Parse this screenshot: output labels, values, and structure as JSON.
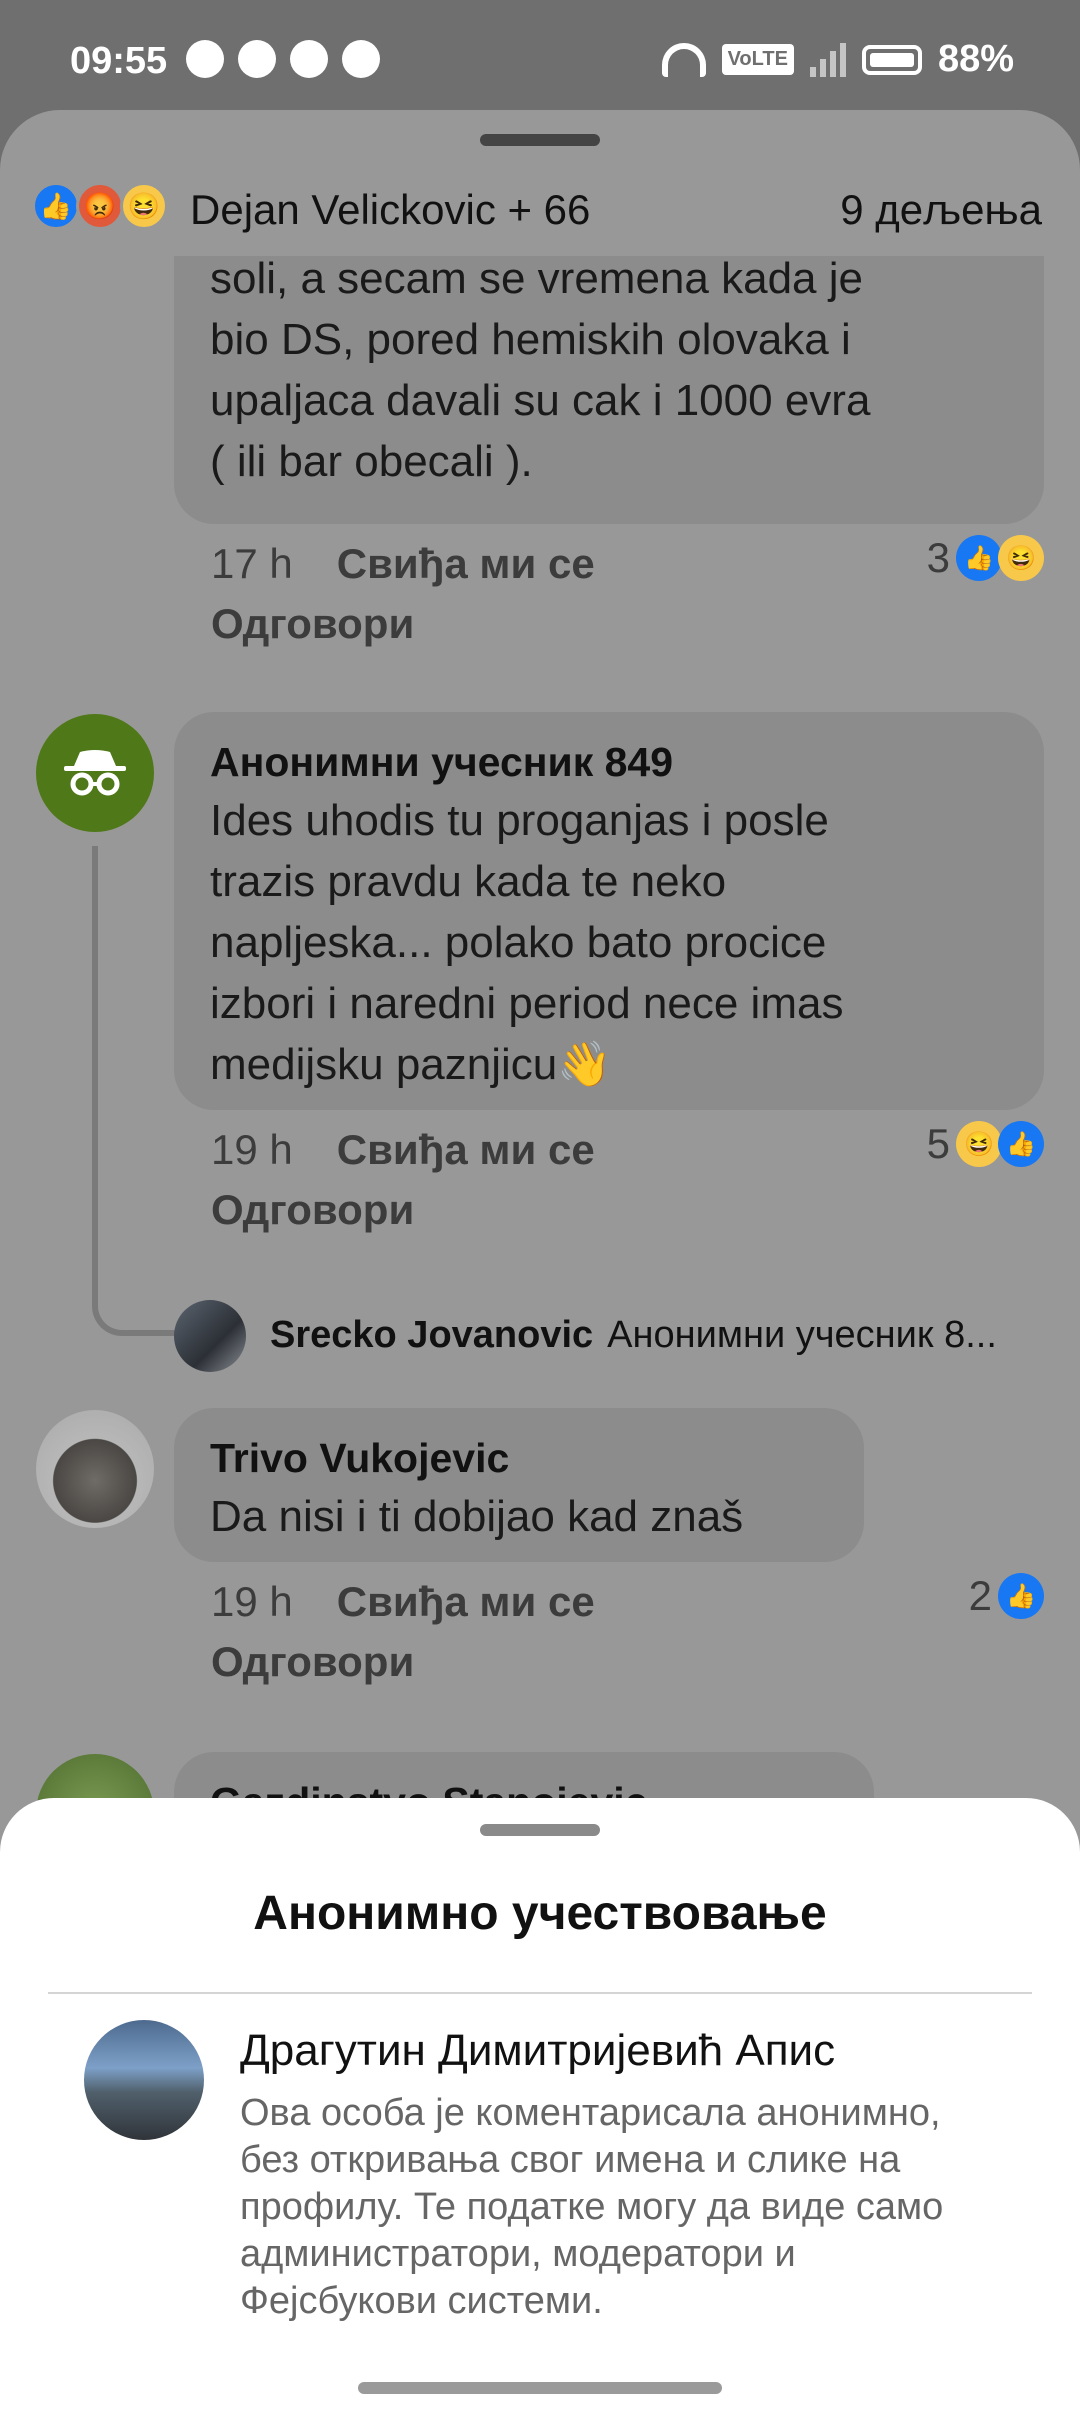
{
  "status_bar": {
    "time": "09:55",
    "network": "VoLTE",
    "battery": "88%"
  },
  "header": {
    "reactors": "Dejan Velickovic + 66",
    "shares": "9 дељења"
  },
  "comments": [
    {
      "text_lines": [
        "soli, a secam se vremena kada je",
        "bio DS, pored hemiskih olovaka i",
        "upaljaca davali su cak i 1000 evra",
        "( ili bar obecali )."
      ],
      "time": "17 h",
      "like_label": "Свиђа ми се",
      "reply_label": "Одговори",
      "reaction_count": "3"
    },
    {
      "author": "Анонимни учесник 849",
      "text_lines": [
        "Ides uhodis tu proganjas i posle",
        "trazis pravdu kada te neko",
        "napljeska... polako bato procice",
        "izbori i naredni period nece imas",
        "medijsku paznjicu👋"
      ],
      "time": "19 h",
      "like_label": "Свиђа ми се",
      "reply_label": "Одговори",
      "reaction_count": "5",
      "reply_preview": {
        "author": "Srecko Jovanovic",
        "text": "Анонимни учесник 8..."
      }
    },
    {
      "author": "Trivo Vukojevic",
      "text": "Da nisi i ti dobijao kad znaš",
      "time": "19 h",
      "like_label": "Свиђа ми се",
      "reply_label": "Одговори",
      "reaction_count": "2"
    },
    {
      "author": "Gazdinstvo Stanojevic"
    }
  ],
  "modal": {
    "title": "Анонимно учествовање",
    "name": "Драгутин Димитријевић Апис",
    "description": "Ова особа је коментарисала анонимно, без откривања свог имена и слике на профилу. Те податке могу да виде само администратори, модератори и Фејсбукови системи."
  },
  "colors": {
    "like_blue": "#1877f2",
    "anon_green": "#4f7818"
  },
  "icons": [
    "alarm-icon",
    "snapchat-icon",
    "person-add-icon",
    "facebook-icon",
    "wifi-icon",
    "signal-icon",
    "battery-icon",
    "like-icon",
    "angry-icon",
    "haha-icon",
    "incognito-icon"
  ]
}
